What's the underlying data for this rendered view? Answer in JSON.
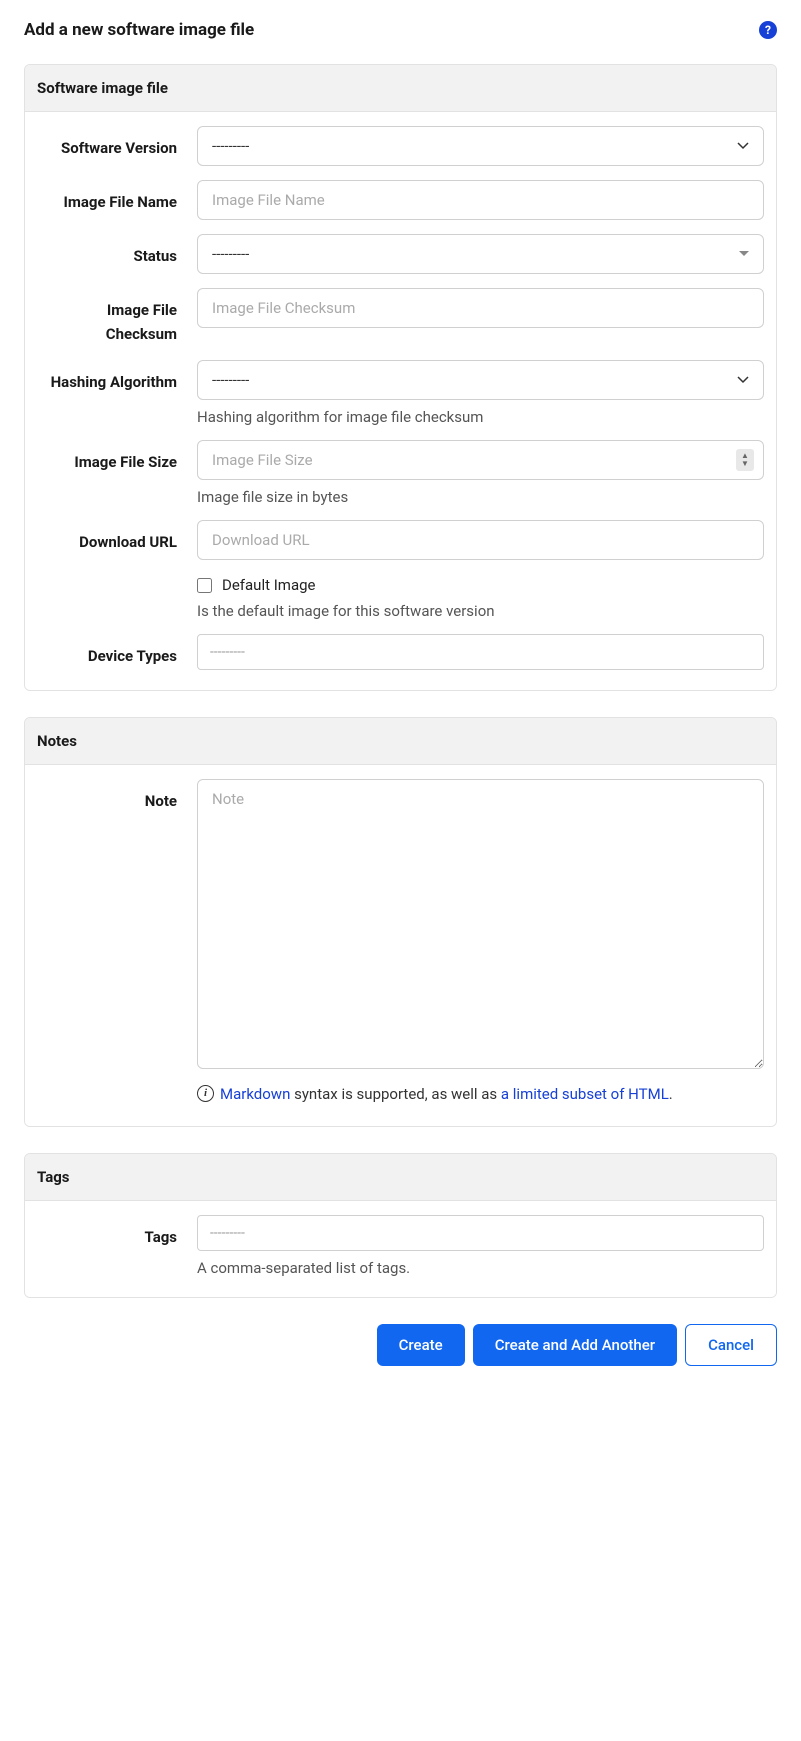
{
  "page": {
    "title": "Add a new software image file"
  },
  "sections": {
    "main": {
      "title": "Software image file"
    },
    "notes": {
      "title": "Notes"
    },
    "tags": {
      "title": "Tags"
    }
  },
  "fields": {
    "software_version": {
      "label": "Software Version",
      "selected": "---------"
    },
    "image_file_name": {
      "label": "Image File Name",
      "placeholder": "Image File Name",
      "value": ""
    },
    "status": {
      "label": "Status",
      "selected": "---------"
    },
    "image_file_checksum": {
      "label": "Image File Checksum",
      "placeholder": "Image File Checksum",
      "value": ""
    },
    "hashing_algorithm": {
      "label": "Hashing Algorithm",
      "selected": "---------",
      "help": "Hashing algorithm for image file checksum"
    },
    "image_file_size": {
      "label": "Image File Size",
      "placeholder": "Image File Size",
      "value": "",
      "help": "Image file size in bytes"
    },
    "download_url": {
      "label": "Download URL",
      "placeholder": "Download URL",
      "value": ""
    },
    "default_image": {
      "label": "Default Image",
      "checked": false,
      "help": "Is the default image for this software version"
    },
    "device_types": {
      "label": "Device Types",
      "value": "---------"
    },
    "note": {
      "label": "Note",
      "placeholder": "Note",
      "value": "",
      "help_pre": " syntax is supported, as well as ",
      "link_markdown": "Markdown",
      "link_html": "a limited subset of HTML",
      "help_post": "."
    },
    "tags": {
      "label": "Tags",
      "value": "---------",
      "help": "A comma-separated list of tags."
    }
  },
  "buttons": {
    "create": "Create",
    "create_another": "Create and Add Another",
    "cancel": "Cancel"
  }
}
